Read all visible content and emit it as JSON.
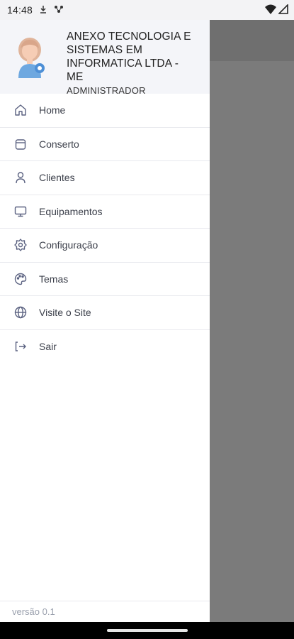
{
  "status_bar": {
    "time": "14:48",
    "icons": [
      "download-icon",
      "network-icon",
      "wifi-icon",
      "signal-icon"
    ]
  },
  "drawer": {
    "company_name": "ANEXO TECNOLOGIA E SISTEMAS EM INFORMATICA LTDA - ME",
    "role": "ADMINISTRADOR",
    "menu": [
      {
        "label": "Home",
        "icon": "home-icon"
      },
      {
        "label": "Conserto",
        "icon": "archive-icon"
      },
      {
        "label": "Clientes",
        "icon": "user-icon"
      },
      {
        "label": "Equipamentos",
        "icon": "monitor-icon"
      },
      {
        "label": "Configuração",
        "icon": "gear-icon"
      },
      {
        "label": "Temas",
        "icon": "palette-icon"
      },
      {
        "label": "Visite o Site",
        "icon": "globe-icon"
      },
      {
        "label": "Sair",
        "icon": "logout-icon"
      }
    ],
    "version": "versão 0.1"
  },
  "colors": {
    "icon": "#5a6180",
    "header_bg": "#f4f5f9",
    "scrim": "#7b7b7b"
  }
}
